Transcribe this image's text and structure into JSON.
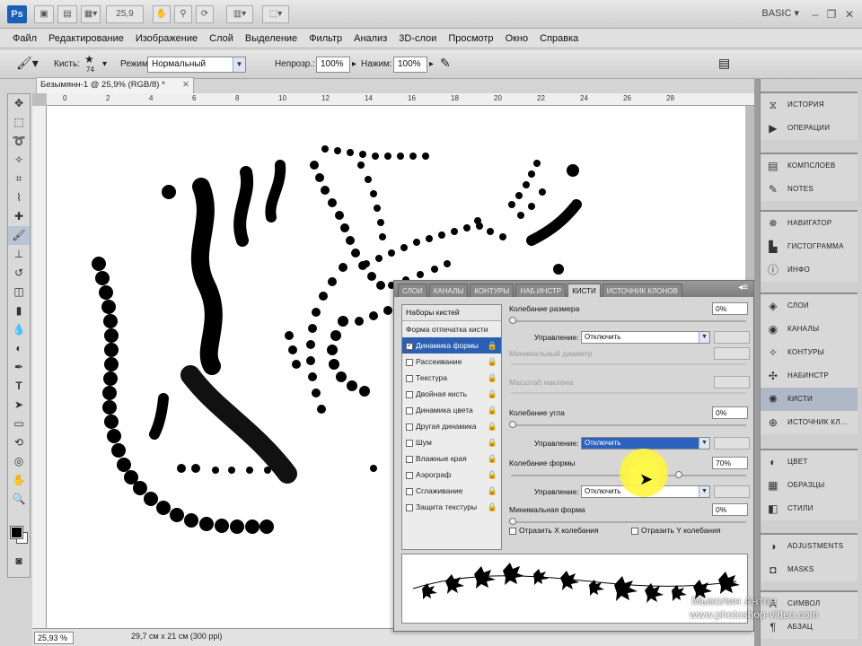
{
  "app": {
    "logo": "Ps",
    "zoom_box": "25,9",
    "workspace": "BASIC"
  },
  "menubar": [
    "Файл",
    "Редактирование",
    "Изображение",
    "Слой",
    "Выделение",
    "Фильтр",
    "Анализ",
    "3D-слои",
    "Просмотр",
    "Окно",
    "Справка"
  ],
  "options": {
    "brush_label": "Кисть:",
    "brush_size": "74",
    "mode_label": "Режим:",
    "mode_value": "Нормальный",
    "opacity_label": "Непрозр.:",
    "opacity_value": "100%",
    "flow_label": "Нажим:",
    "flow_value": "100%"
  },
  "document": {
    "tab_title": "Безымянн-1 @ 25,9% (RGB/8) *",
    "ruler_numbers": [
      "0",
      "2",
      "4",
      "6",
      "8",
      "10",
      "12",
      "14",
      "16",
      "18",
      "20",
      "22",
      "24",
      "26",
      "28"
    ],
    "status_zoom": "25,93 %",
    "status_info": "29,7 см x 21 см (300 ppi)"
  },
  "brush_panel": {
    "tabs": [
      "СЛОИ",
      "КАНАЛЫ",
      "КОНТУРЫ",
      "НАБ.ИНСТР",
      "КИСТИ",
      "ИСТОЧНИК КЛОНОВ"
    ],
    "active_tab": "КИСТИ",
    "presets_header": "Наборы кистей",
    "tip_shape": "Форма отпечатка кисти",
    "options": [
      {
        "label": "Динамика формы",
        "checked": true,
        "selected": true
      },
      {
        "label": "Рассеивание",
        "checked": false
      },
      {
        "label": "Текстура",
        "checked": false
      },
      {
        "label": "Двойная кисть",
        "checked": false
      },
      {
        "label": "Динамика цвета",
        "checked": false
      },
      {
        "label": "Другая динамика",
        "checked": false
      },
      {
        "label": "Шум",
        "checked": false
      },
      {
        "label": "Влажные края",
        "checked": false
      },
      {
        "label": "Аэрограф",
        "checked": false
      },
      {
        "label": "Сглаживание",
        "checked": false
      },
      {
        "label": "Защита текстуры",
        "checked": false
      }
    ],
    "size_jitter_label": "Колебание размера",
    "size_jitter_value": "0%",
    "control_label": "Управление:",
    "control_size": "Отключить",
    "min_diameter_label": "Минимальный диаметр",
    "tilt_scale_label": "Масштаб наклона",
    "angle_jitter_label": "Колебание угла",
    "angle_jitter_value": "0%",
    "control_angle": "Отключить",
    "roundness_jitter_label": "Колебание формы",
    "roundness_jitter_value": "70%",
    "control_roundness": "Отключить",
    "min_roundness_label": "Минимальная форма",
    "min_roundness_value": "0%",
    "flip_x": "Отразить X колебания",
    "flip_y": "Отразить Y колебания"
  },
  "dock": {
    "groups": [
      [
        {
          "label": "ИСТОРИЯ",
          "icon": "history-icon"
        },
        {
          "label": "ОПЕРАЦИИ",
          "icon": "actions-icon"
        }
      ],
      [
        {
          "label": "КОМПСЛОЕВ",
          "icon": "layer-comps-icon"
        },
        {
          "label": "NOTES",
          "icon": "notes-icon"
        }
      ],
      [
        {
          "label": "НАВИГАТОР",
          "icon": "navigator-icon"
        },
        {
          "label": "ГИСТОГРАММА",
          "icon": "histogram-icon"
        },
        {
          "label": "ИНФО",
          "icon": "info-icon"
        }
      ],
      [
        {
          "label": "СЛОИ",
          "icon": "layers-icon"
        },
        {
          "label": "КАНАЛЫ",
          "icon": "channels-icon"
        },
        {
          "label": "КОНТУРЫ",
          "icon": "paths-icon"
        },
        {
          "label": "НАБИНСТР",
          "icon": "tool-presets-icon"
        },
        {
          "label": "КИСТИ",
          "icon": "brushes-icon",
          "active": true
        },
        {
          "label": "ИСТОЧНИК КЛ...",
          "icon": "clone-source-icon"
        }
      ],
      [
        {
          "label": "ЦВЕТ",
          "icon": "color-icon"
        },
        {
          "label": "ОБРАЗЦЫ",
          "icon": "swatches-icon"
        },
        {
          "label": "СТИЛИ",
          "icon": "styles-icon"
        }
      ],
      [
        {
          "label": "ADJUSTMENTS",
          "icon": "adjustments-icon"
        },
        {
          "label": "MASKS",
          "icon": "masks-icon"
        }
      ],
      [
        {
          "label": "СИМВОЛ",
          "icon": "character-icon"
        },
        {
          "label": "АБЗАЦ",
          "icon": "paragraph-icon"
        }
      ]
    ]
  },
  "watermark": {
    "author": "Мыколин Антон",
    "site": "www.photoshop-video.com"
  },
  "colors": {
    "accent_selection": "#2b5fb3",
    "active_dock": "#aeb8c6"
  }
}
